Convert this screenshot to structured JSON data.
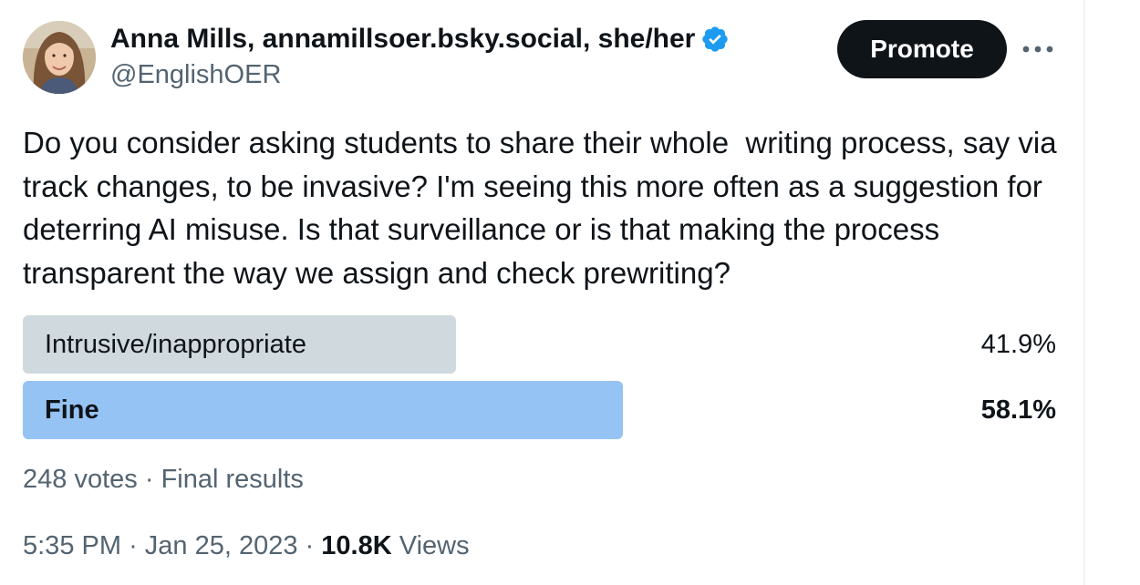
{
  "author": {
    "display_name": "Anna Mills, annamillsoer.bsky.social, she/her",
    "handle": "@EnglishOER",
    "avatar_icon": "user-avatar-photo",
    "verified_icon": "verified-badge-icon",
    "verified_color": "#1d9bf0"
  },
  "actions": {
    "promote_label": "Promote",
    "more_icon": "more-horizontal-icon"
  },
  "tweet": {
    "text": "Do you consider asking students to share their whole  writing process, say via track changes, to be invasive? I'm seeing this more often as a suggestion for deterring AI misuse. Is that surveillance or is that making the process transparent the way we assign and check prewriting?"
  },
  "poll": {
    "options": [
      {
        "label": "Intrusive/inappropriate",
        "percent_text": "41.9%",
        "fraction": 0.419,
        "winner": false
      },
      {
        "label": "Fine",
        "percent_text": "58.1%",
        "fraction": 0.581,
        "winner": true
      }
    ],
    "votes": "248 votes",
    "separator": "·",
    "status": "Final results",
    "bar_colors": {
      "winner": "#95c3f3",
      "other": "#cfd9de"
    }
  },
  "meta": {
    "time": "5:35 PM",
    "separator": "·",
    "date": "Jan 25, 2023",
    "views_count": "10.8K",
    "views_label": "Views"
  }
}
